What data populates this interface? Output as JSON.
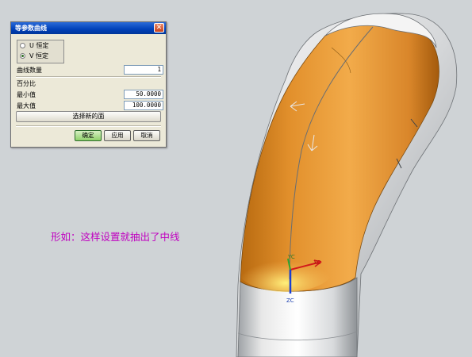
{
  "dialog": {
    "title": "等参数曲线",
    "close_symbol": "✕",
    "options": [
      {
        "label": "U 恒定",
        "selected": false
      },
      {
        "label": "V 恒定",
        "selected": true
      }
    ],
    "curve_count": {
      "label": "曲线数量",
      "value": "1"
    },
    "percent_label": "百分比",
    "min": {
      "label": "最小值",
      "value": "50.0000"
    },
    "max": {
      "label": "最大值",
      "value": "100.0000"
    },
    "select_face_label": "选择新的面",
    "buttons": {
      "ok": "确定",
      "apply": "应用",
      "cancel": "取消"
    }
  },
  "annotation": "形如：这样设置就抽出了中线",
  "axes": {
    "x": "XC",
    "y": "YC",
    "z": "ZC"
  },
  "colors": {
    "accent_orange": "#e8962a",
    "dialog_title": "#0040b8",
    "annotation": "#c000c0"
  }
}
